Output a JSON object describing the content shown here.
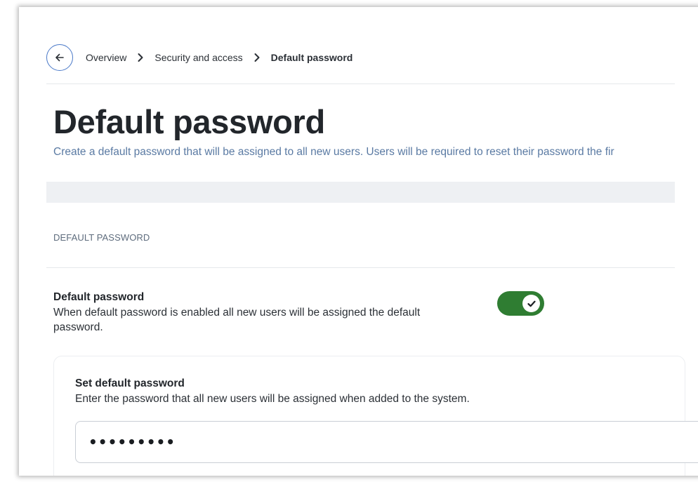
{
  "breadcrumb": {
    "back_icon": "arrow-left-icon",
    "items": [
      "Overview",
      "Security and access",
      "Default password"
    ],
    "separator_icon": "chevron-right-icon"
  },
  "page": {
    "title": "Default password",
    "description": "Create a default password that will be assigned to all new users. Users will be required to reset their password the fir"
  },
  "section": {
    "label": "DEFAULT PASSWORD"
  },
  "setting": {
    "title": "Default password",
    "description": "When default password is enabled all new users will be assigned the default password.",
    "toggle_on": true,
    "toggle_icon": "check-icon"
  },
  "password_card": {
    "title": "Set default password",
    "description": "Enter the password that all new users will be assigned when added to the system.",
    "value": "•••••••••"
  },
  "colors": {
    "accent_blue": "#4a79c8",
    "toggle_green": "#2f7d32",
    "description_blue": "#5a7aa3"
  }
}
